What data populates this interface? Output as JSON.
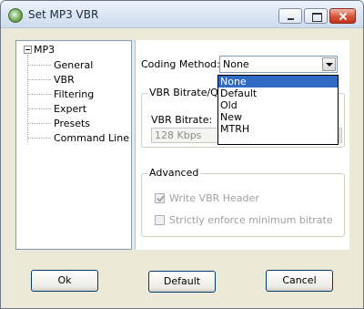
{
  "window": {
    "title": "Set MP3 VBR"
  },
  "tree": {
    "root": "MP3",
    "items": [
      "General",
      "VBR",
      "Filtering",
      "Expert",
      "Presets",
      "Command Line"
    ]
  },
  "coding": {
    "label": "Coding Method:",
    "value": "None",
    "options": [
      "None",
      "Default",
      "Old",
      "New",
      "MTRH"
    ],
    "selected_index": 0
  },
  "vbr": {
    "group_title": "VBR Bitrate/Quality",
    "bitrate_label": "VBR Bitrate:",
    "bitrate_value": "128 Kbps"
  },
  "advanced": {
    "title": "Advanced",
    "write_header": {
      "label": "Write VBR Header",
      "checked": true
    },
    "enforce_min": {
      "label": "Strictly enforce minimum bitrate",
      "checked": false
    }
  },
  "buttons": {
    "ok": "Ok",
    "default": "Default",
    "cancel": "Cancel"
  },
  "colors": {
    "selection": "#316ac5",
    "dialog_bg": "#ece9d8"
  }
}
